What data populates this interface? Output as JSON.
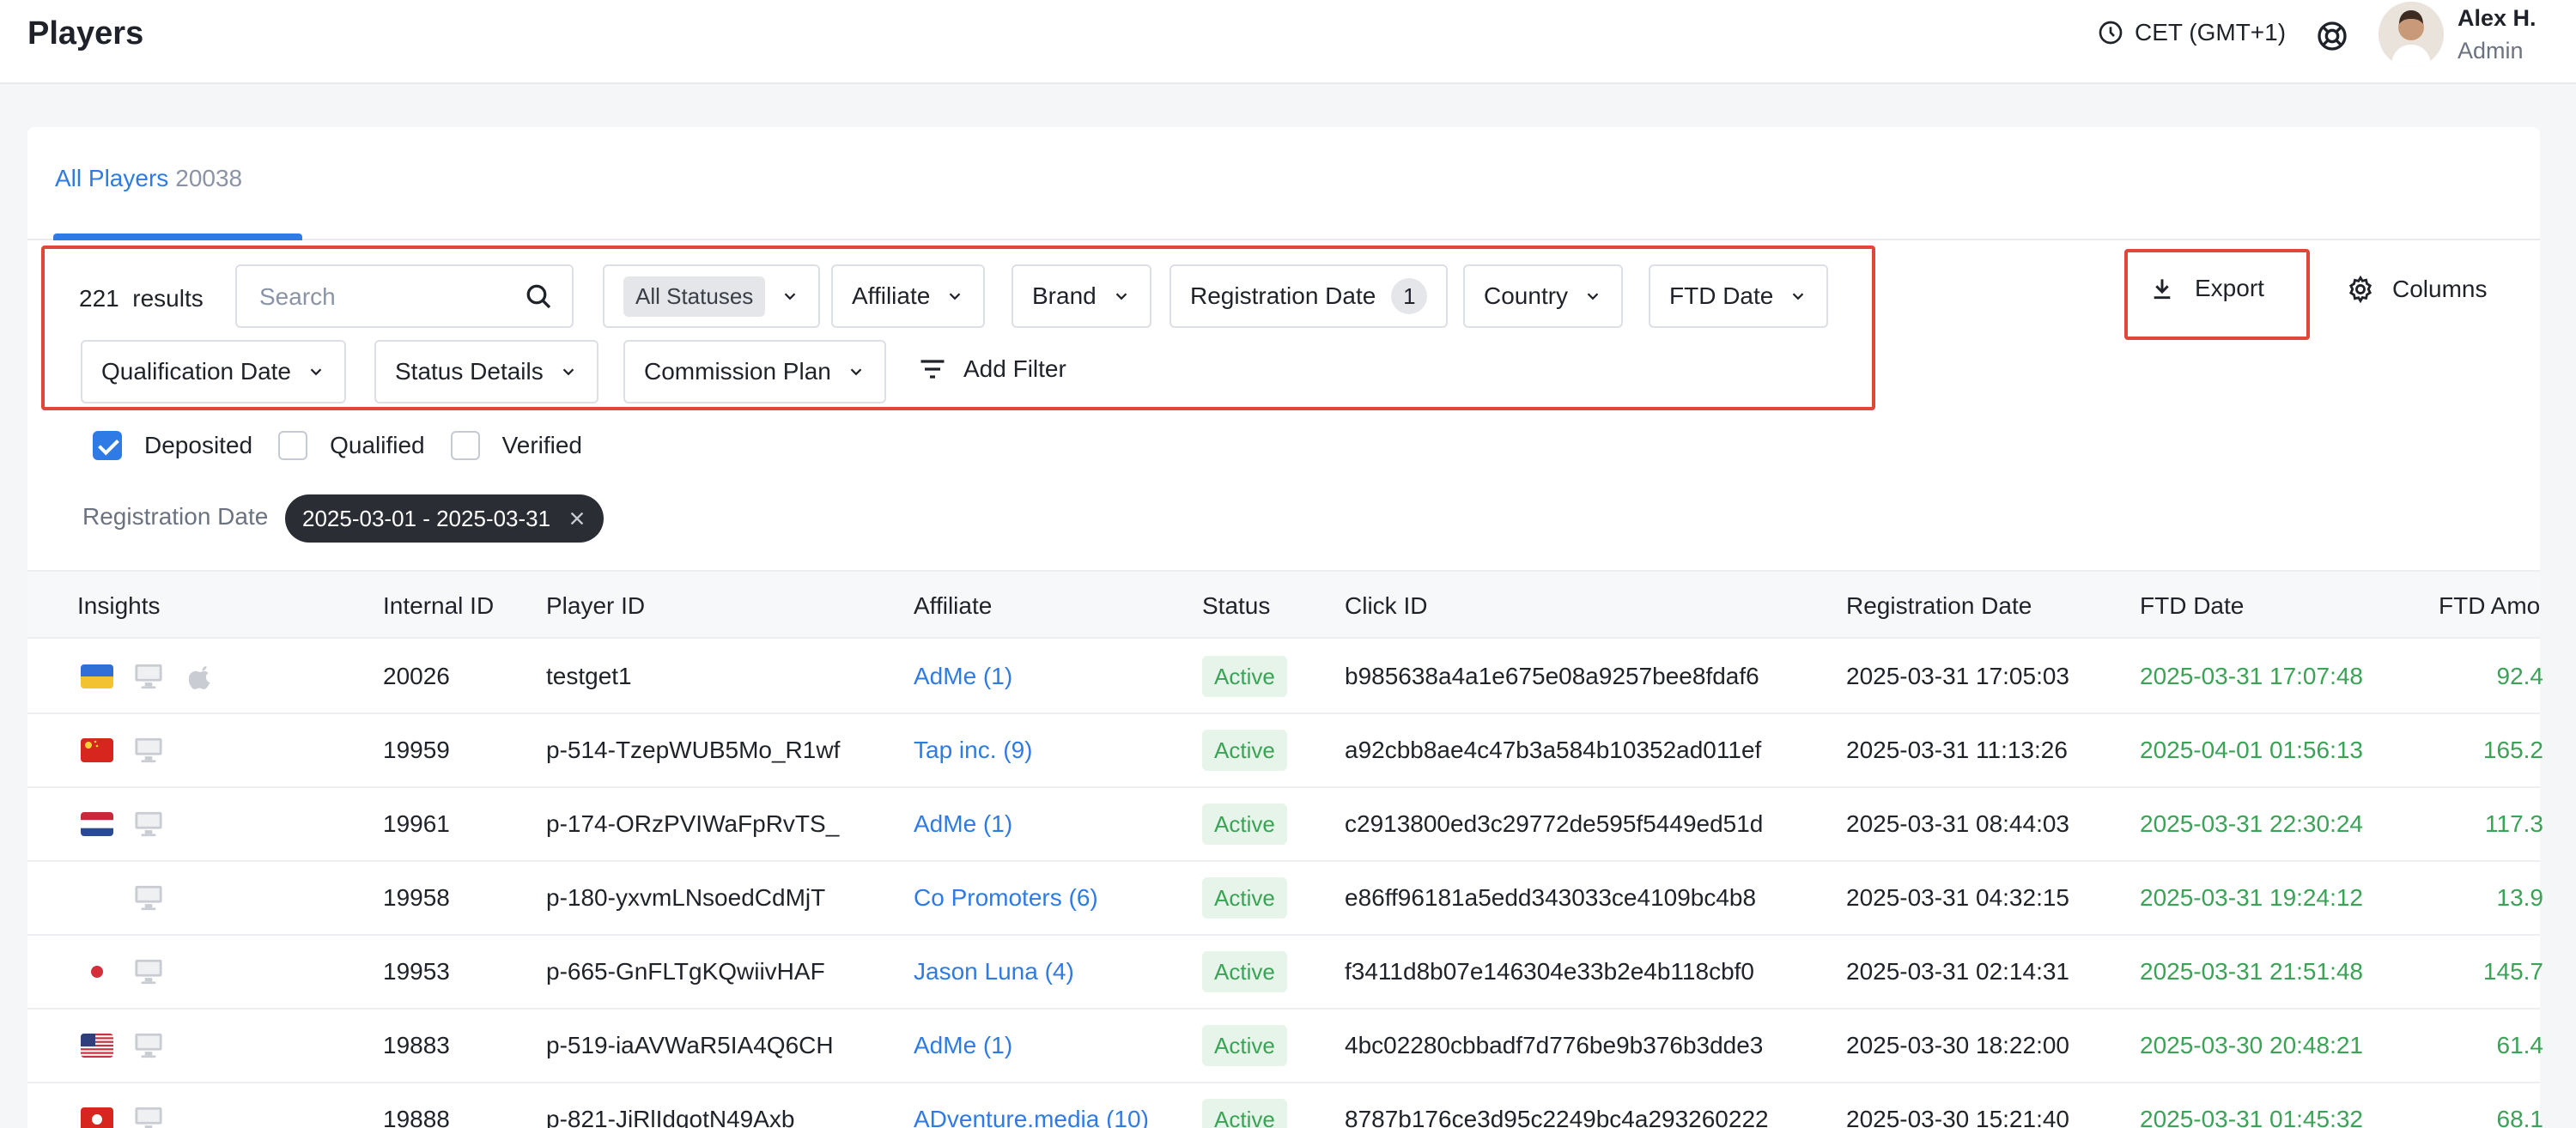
{
  "header": {
    "title": "Players",
    "timezone": "CET (GMT+1)",
    "user_name": "Alex H.",
    "user_role": "Admin"
  },
  "tabs": [
    {
      "label": "All Players",
      "count": "20038"
    }
  ],
  "toolbar": {
    "results_count": "221",
    "results_label": "results",
    "search_placeholder": "Search",
    "filters": {
      "status": "All Statuses",
      "affiliate": "Affiliate",
      "brand": "Brand",
      "registration_date": "Registration Date",
      "registration_date_badge": "1",
      "country": "Country",
      "ftd_date": "FTD Date",
      "qualification_date": "Qualification Date",
      "status_details": "Status Details",
      "commission_plan": "Commission Plan",
      "add_filter": "Add Filter"
    },
    "export_label": "Export",
    "columns_label": "Columns"
  },
  "checkboxes": [
    {
      "label": "Deposited",
      "checked": true
    },
    {
      "label": "Qualified",
      "checked": false
    },
    {
      "label": "Verified",
      "checked": false
    }
  ],
  "active_filter": {
    "label": "Registration Date",
    "value": "2025-03-01 - 2025-03-31"
  },
  "table": {
    "columns": [
      "Insights",
      "Internal ID",
      "Player ID",
      "Affiliate",
      "Status",
      "Click ID",
      "Registration Date",
      "FTD Date",
      "FTD Amo"
    ],
    "rows": [
      {
        "flag": "ukraine",
        "apple": true,
        "internal_id": "20026",
        "player_id": "testget1",
        "affiliate": "AdMe (1)",
        "status": "Active",
        "click_id": "b985638a4a1e675e08a9257bee8fdaf6",
        "registration_date": "2025-03-31 17:05:03",
        "ftd_date": "2025-03-31 17:07:48",
        "ftd_amount": "92.4"
      },
      {
        "flag": "china",
        "apple": false,
        "internal_id": "19959",
        "player_id": "p-514-TzepWUB5Mo_R1wf",
        "affiliate": "Tap inc. (9)",
        "status": "Active",
        "click_id": "a92cbb8ae4c47b3a584b10352ad011ef",
        "registration_date": "2025-03-31 11:13:26",
        "ftd_date": "2025-04-01 01:56:13",
        "ftd_amount": "165.2"
      },
      {
        "flag": "netherlands",
        "apple": false,
        "internal_id": "19961",
        "player_id": "p-174-ORzPVIWaFpRvTS_",
        "affiliate": "AdMe (1)",
        "status": "Active",
        "click_id": "c2913800ed3c29772de595f5449ed51d",
        "registration_date": "2025-03-31 08:44:03",
        "ftd_date": "2025-03-31 22:30:24",
        "ftd_amount": "117.3"
      },
      {
        "flag": "none",
        "apple": false,
        "internal_id": "19958",
        "player_id": "p-180-yxvmLNsoedCdMjT",
        "affiliate": "Co Promoters (6)",
        "status": "Active",
        "click_id": "e86ff96181a5edd343033ce4109bc4b8",
        "registration_date": "2025-03-31 04:32:15",
        "ftd_date": "2025-03-31 19:24:12",
        "ftd_amount": "13.9"
      },
      {
        "flag": "japan",
        "apple": false,
        "internal_id": "19953",
        "player_id": "p-665-GnFLTgKQwiivHAF",
        "affiliate": "Jason Luna (4)",
        "status": "Active",
        "click_id": "f3411d8b07e146304e33b2e4b118cbf0",
        "registration_date": "2025-03-31 02:14:31",
        "ftd_date": "2025-03-31 21:51:48",
        "ftd_amount": "145.7"
      },
      {
        "flag": "usa",
        "apple": false,
        "internal_id": "19883",
        "player_id": "p-519-iaAVWaR5IA4Q6CH",
        "affiliate": "AdMe (1)",
        "status": "Active",
        "click_id": "4bc02280cbbadf7d776be9b376b3dde3",
        "registration_date": "2025-03-30 18:22:00",
        "ftd_date": "2025-03-30 20:48:21",
        "ftd_amount": "61.4"
      },
      {
        "flag": "hongkong",
        "apple": false,
        "internal_id": "19888",
        "player_id": "p-821-JiRlIdqotN49Axb",
        "affiliate": "ADventure.media (10)",
        "status": "Active",
        "click_id": "8787b176ce3d95c2249bc4a293260222",
        "registration_date": "2025-03-30 15:21:40",
        "ftd_date": "2025-03-31 01:45:32",
        "ftd_amount": "68.1"
      }
    ]
  },
  "colors": {
    "accent": "#2f7be5",
    "positive": "#3aa356",
    "highlight": "#e0473a"
  }
}
